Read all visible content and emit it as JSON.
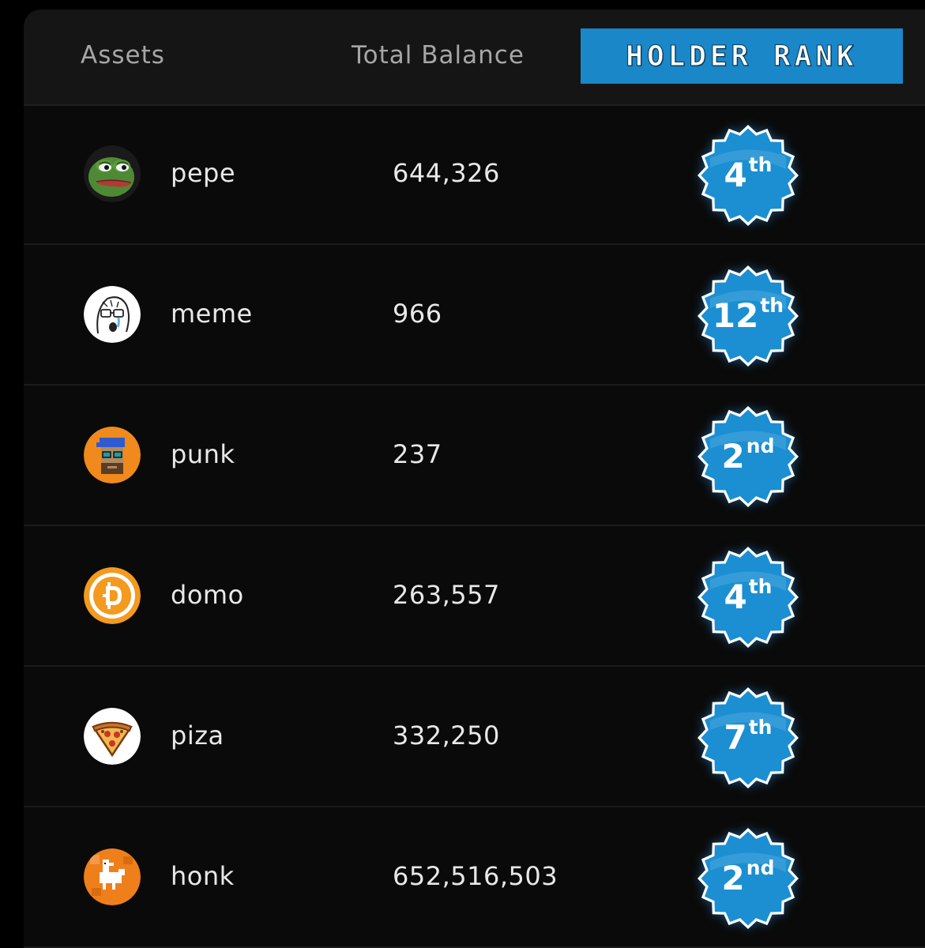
{
  "header": {
    "assets_label": "Assets",
    "balance_label": "Total Balance",
    "rank_tab_label": "HOLDER RANK"
  },
  "colors": {
    "accent": "#1a87c8",
    "badge_fill": "#1b8fd2",
    "background": "#0a0a0a"
  },
  "rows": [
    {
      "name": "pepe",
      "balance": "644,326",
      "rank_num": "4",
      "rank_suffix": "th",
      "icon": "pepe-frog-icon"
    },
    {
      "name": "meme",
      "balance": "966",
      "rank_num": "12",
      "rank_suffix": "th",
      "icon": "wojak-meme-icon"
    },
    {
      "name": "punk",
      "balance": "237",
      "rank_num": "2",
      "rank_suffix": "nd",
      "icon": "cryptopunk-icon"
    },
    {
      "name": "domo",
      "balance": "263,557",
      "rank_num": "4",
      "rank_suffix": "th",
      "icon": "domo-coin-icon"
    },
    {
      "name": "piza",
      "balance": "332,250",
      "rank_num": "7",
      "rank_suffix": "th",
      "icon": "pizza-slice-icon"
    },
    {
      "name": "honk",
      "balance": "652,516,503",
      "rank_num": "2",
      "rank_suffix": "nd",
      "icon": "pixel-goose-icon"
    }
  ]
}
